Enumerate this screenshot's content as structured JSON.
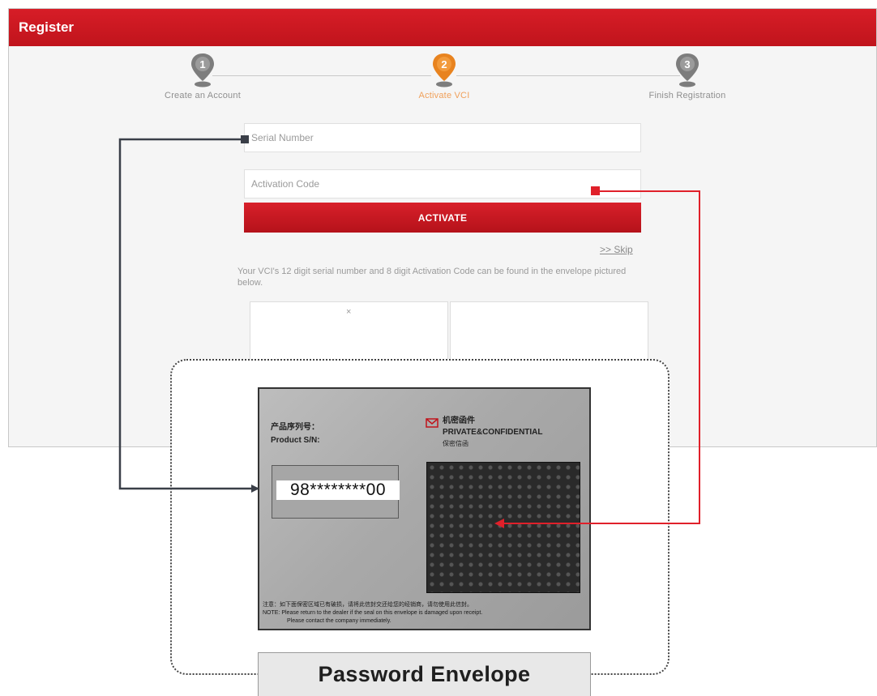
{
  "window": {
    "title": "Register"
  },
  "steps": [
    {
      "number": "1",
      "label": "Create an Account",
      "state": "done"
    },
    {
      "number": "2",
      "label": "Activate VCI",
      "state": "active"
    },
    {
      "number": "3",
      "label": "Finish Registration",
      "state": "pending"
    }
  ],
  "form": {
    "serial_placeholder": "Serial Number",
    "activation_placeholder": "Activation Code",
    "activate_label": "ACTIVATE",
    "skip_label": ">> Skip",
    "help_text": "Your VCI's 12 digit serial number and 8 digit Activation Code can be found in the envelope pictured below.",
    "close_glyph": "×"
  },
  "envelope": {
    "sn_label_cn": "产品序列号：",
    "sn_label_en": "Product S/N:",
    "sn_value": "98********00",
    "confidential_cn": "机密函件",
    "confidential_en": "PRIVATE&CONFIDENTIAL",
    "confidential_sub": "保密信函",
    "note_cn": "注意：如下面保密区域已有破损，请将此信封交还给您的经销商，请勿使用此信封。",
    "note_en": "NOTE: Please return to the dealer if the seal on this envelope is damaged upon receipt.",
    "note_en2": "Please contact the company immediately.",
    "caption": "Password Envelope"
  },
  "colors": {
    "brand_red": "#c8161e",
    "active_step": "#e8831f",
    "inactive_step": "#8a8a8a",
    "serial_arrow": "#3a3f48",
    "code_arrow": "#e0202a"
  }
}
